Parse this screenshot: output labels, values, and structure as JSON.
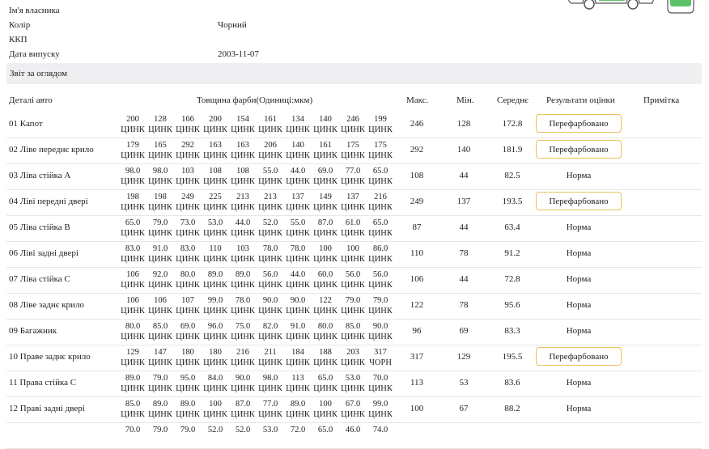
{
  "info": [
    {
      "label": "Ім'я власника",
      "value": ""
    },
    {
      "label": "Колір",
      "value": "Чорний"
    },
    {
      "label": "ККП",
      "value": ""
    },
    {
      "label": "Дата випуску",
      "value": "2003-11-07"
    }
  ],
  "section_title": "Звіт за оглядом",
  "headers": {
    "part": "Деталі авто",
    "thickness": "Товщина фарби(Одиниці:мкм)",
    "max": "Макс.",
    "min": "Мін.",
    "avg": "Середнє",
    "result": "Результати оцінки",
    "note": "Примітка"
  },
  "rows": [
    {
      "part": "01  Капот",
      "vals": [
        "200",
        "128",
        "166",
        "200",
        "154",
        "161",
        "134",
        "140",
        "246",
        "199"
      ],
      "mats": [
        "ЦИНК",
        "ЦИНК",
        "ЦИНК",
        "ЦИНК",
        "ЦИНК",
        "ЦИНК",
        "ЦИНК",
        "ЦИНК",
        "ЦИНК",
        "ЦИНК"
      ],
      "max": "246",
      "min": "128",
      "avg": "172.8",
      "result": "Перефарбовано",
      "flag": true
    },
    {
      "part": "02  Ліве переднє крило",
      "vals": [
        "179",
        "165",
        "292",
        "163",
        "163",
        "206",
        "140",
        "161",
        "175",
        "175"
      ],
      "mats": [
        "ЦИНК",
        "ЦИНК",
        "ЦИНК",
        "ЦИНК",
        "ЦИНК",
        "ЦИНК",
        "ЦИНК",
        "ЦИНК",
        "ЦИНК",
        "ЦИНК"
      ],
      "max": "292",
      "min": "140",
      "avg": "181.9",
      "result": "Перефарбовано",
      "flag": true
    },
    {
      "part": "03  Ліва стійка А",
      "vals": [
        "98.0",
        "98.0",
        "103",
        "108",
        "108",
        "55.0",
        "44.0",
        "69.0",
        "77.0",
        "65.0"
      ],
      "mats": [
        "ЦИНК",
        "ЦИНК",
        "ЦИНК",
        "ЦИНК",
        "ЦИНК",
        "ЦИНК",
        "ЦИНК",
        "ЦИНК",
        "ЦИНК",
        "ЦИНК"
      ],
      "max": "108",
      "min": "44",
      "avg": "82.5",
      "result": "Норма",
      "flag": false
    },
    {
      "part": "04  Ліві передні двері",
      "vals": [
        "198",
        "198",
        "249",
        "225",
        "213",
        "213",
        "137",
        "149",
        "137",
        "216"
      ],
      "mats": [
        "ЦИНК",
        "ЦИНК",
        "ЦИНК",
        "ЦИНК",
        "ЦИНК",
        "ЦИНК",
        "ЦИНК",
        "ЦИНК",
        "ЦИНК",
        "ЦИНК"
      ],
      "max": "249",
      "min": "137",
      "avg": "193.5",
      "result": "Перефарбовано",
      "flag": true
    },
    {
      "part": "05  Ліва стійка В",
      "vals": [
        "65.0",
        "79.0",
        "73.0",
        "53.0",
        "44.0",
        "52.0",
        "55.0",
        "87.0",
        "61.0",
        "65.0"
      ],
      "mats": [
        "ЦИНК",
        "ЦИНК",
        "ЦИНК",
        "ЦИНК",
        "ЦИНК",
        "ЦИНК",
        "ЦИНК",
        "ЦИНК",
        "ЦИНК",
        "ЦИНК"
      ],
      "max": "87",
      "min": "44",
      "avg": "63.4",
      "result": "Норма",
      "flag": false
    },
    {
      "part": "06  Ліві задні двері",
      "vals": [
        "83.0",
        "91.0",
        "83.0",
        "110",
        "103",
        "78.0",
        "78.0",
        "100",
        "100",
        "86.0"
      ],
      "mats": [
        "ЦИНК",
        "ЦИНК",
        "ЦИНК",
        "ЦИНК",
        "ЦИНК",
        "ЦИНК",
        "ЦИНК",
        "ЦИНК",
        "ЦИНК",
        "ЦИНК"
      ],
      "max": "110",
      "min": "78",
      "avg": "91.2",
      "result": "Норма",
      "flag": false
    },
    {
      "part": "07  Ліва стійка С",
      "vals": [
        "106",
        "92.0",
        "80.0",
        "89.0",
        "89.0",
        "56.0",
        "44.0",
        "60.0",
        "56.0",
        "56.0"
      ],
      "mats": [
        "ЦИНК",
        "ЦИНК",
        "ЦИНК",
        "ЦИНК",
        "ЦИНК",
        "ЦИНК",
        "ЦИНК",
        "ЦИНК",
        "ЦИНК",
        "ЦИНК"
      ],
      "max": "106",
      "min": "44",
      "avg": "72.8",
      "result": "Норма",
      "flag": false
    },
    {
      "part": "08  Ліве заднє крило",
      "vals": [
        "106",
        "106",
        "107",
        "99.0",
        "78.0",
        "90.0",
        "90.0",
        "122",
        "79.0",
        "79.0"
      ],
      "mats": [
        "ЦИНК",
        "ЦИНК",
        "ЦИНК",
        "ЦИНК",
        "ЦИНК",
        "ЦИНК",
        "ЦИНК",
        "ЦИНК",
        "ЦИНК",
        "ЦИНК"
      ],
      "max": "122",
      "min": "78",
      "avg": "95.6",
      "result": "Норма",
      "flag": false
    },
    {
      "part": "09  Багажник",
      "vals": [
        "80.0",
        "85.0",
        "69.0",
        "96.0",
        "75.0",
        "82.0",
        "91.0",
        "80.0",
        "85.0",
        "90.0"
      ],
      "mats": [
        "ЦИНК",
        "ЦИНК",
        "ЦИНК",
        "ЦИНК",
        "ЦИНК",
        "ЦИНК",
        "ЦИНК",
        "ЦИНК",
        "ЦИНК",
        "ЦИНК"
      ],
      "max": "96",
      "min": "69",
      "avg": "83.3",
      "result": "Норма",
      "flag": false
    },
    {
      "part": "10  Праве заднє крило",
      "vals": [
        "129",
        "147",
        "180",
        "180",
        "216",
        "211",
        "184",
        "188",
        "203",
        "317"
      ],
      "mats": [
        "ЦИНК",
        "ЦИНК",
        "ЦИНК",
        "ЦИНК",
        "ЦИНК",
        "ЦИНК",
        "ЦИНК",
        "ЦИНК",
        "ЦИНК",
        "ЧОРН"
      ],
      "max": "317",
      "min": "129",
      "avg": "195.5",
      "result": "Перефарбовано",
      "flag": true
    },
    {
      "part": "11  Права стійка С",
      "vals": [
        "89.0",
        "79.0",
        "95.0",
        "84.0",
        "90.0",
        "98.0",
        "113",
        "65.0",
        "53.0",
        "70.0"
      ],
      "mats": [
        "ЦИНК",
        "ЦИНК",
        "ЦИНК",
        "ЦИНК",
        "ЦИНК",
        "ЦИНК",
        "ЦИНК",
        "ЦИНК",
        "ЦИНК",
        "ЦИНК"
      ],
      "max": "113",
      "min": "53",
      "avg": "83.6",
      "result": "Норма",
      "flag": false
    },
    {
      "part": "12  Праві задні двері",
      "vals": [
        "85.0",
        "89.0",
        "89.0",
        "100",
        "87.0",
        "77.0",
        "89.0",
        "100",
        "67.0",
        "99.0"
      ],
      "mats": [
        "ЦИНК",
        "ЦИНК",
        "ЦИНК",
        "ЦИНК",
        "ЦИНК",
        "ЦИНК",
        "ЦИНК",
        "ЦИНК",
        "ЦИНК",
        "ЦИНК"
      ],
      "max": "100",
      "min": "67",
      "avg": "88.2",
      "result": "Норма",
      "flag": false
    },
    {
      "part": "",
      "vals": [
        "70.0",
        "79.0",
        "79.0",
        "52.0",
        "52.0",
        "53.0",
        "72.0",
        "65.0",
        "46.0",
        "74.0"
      ],
      "mats": [
        "",
        "",
        "",
        "",
        "",
        "",
        "",
        "",
        "",
        ""
      ],
      "max": "",
      "min": "",
      "avg": "",
      "result": "",
      "flag": false
    }
  ],
  "colors": {
    "badge_border": "#e8c25a",
    "section_bg": "#efeff2"
  }
}
